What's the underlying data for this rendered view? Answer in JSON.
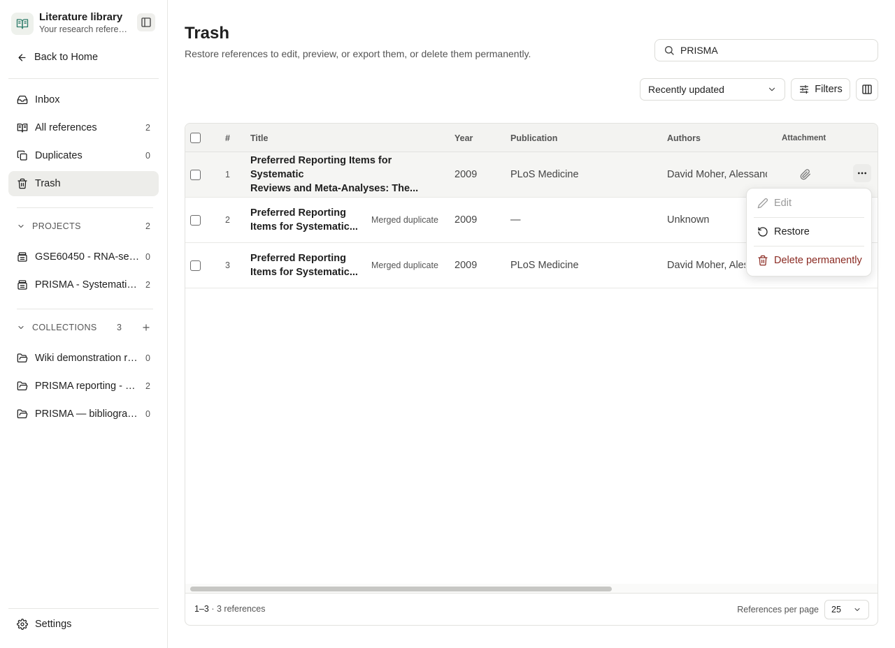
{
  "sidebar": {
    "brand_title": "Literature library",
    "brand_subtitle": "Your research references",
    "back_label": "Back to Home",
    "nav": [
      {
        "label": "Inbox",
        "count": ""
      },
      {
        "label": "All references",
        "count": "2"
      },
      {
        "label": "Duplicates",
        "count": "0"
      },
      {
        "label": "Trash",
        "count": ""
      }
    ],
    "projects": {
      "label": "PROJECTS",
      "count": "2",
      "items": [
        {
          "label": "GSE60450 - RNA-seq analysis",
          "count": "0"
        },
        {
          "label": "PRISMA - Systematic reviews",
          "count": "2"
        }
      ]
    },
    "collections": {
      "label": "COLLECTIONS",
      "count": "3",
      "items": [
        {
          "label": "Wiki demonstration references",
          "count": "0"
        },
        {
          "label": "PRISMA reporting - Core papers",
          "count": "2"
        },
        {
          "label": "PRISMA — bibliography",
          "count": "0"
        }
      ]
    },
    "settings_label": "Settings"
  },
  "main": {
    "title": "Trash",
    "subtitle": "Restore references to edit, preview, or export them, or delete them permanently.",
    "search_value": "PRISMA",
    "sort_value": "Recently updated",
    "filters_label": "Filters"
  },
  "table": {
    "columns": {
      "num": "#",
      "title": "Title",
      "year": "Year",
      "publication": "Publication",
      "authors": "Authors",
      "attachment": "Attachment"
    },
    "rows": [
      {
        "num": "1",
        "title_line1": "Preferred Reporting Items for Systematic",
        "title_line2": "Reviews and Meta-Analyses: The...",
        "badge": "",
        "year": "2009",
        "publication": "PLoS Medicine",
        "authors": "David Moher, Alessandro Liberati"
      },
      {
        "num": "2",
        "title_line1": "Preferred Reporting",
        "title_line2": "Items for Systematic...",
        "badge": "Merged duplicate",
        "year": "2009",
        "publication": "—",
        "authors": "Unknown"
      },
      {
        "num": "3",
        "title_line1": "Preferred Reporting",
        "title_line2": "Items for Systematic...",
        "badge": "Merged duplicate",
        "year": "2009",
        "publication": "PLoS Medicine",
        "authors": "David Moher, Alessandro Liberati"
      }
    ],
    "footer_range": "1–3",
    "footer_count": "· 3 references",
    "per_page_label": "References per page",
    "per_page_value": "25"
  },
  "menu": {
    "edit": "Edit",
    "restore": "Restore",
    "delete": "Delete permanently"
  },
  "colors": {
    "danger": "#8a2a22",
    "active_bg": "#ededea",
    "accent": "#2f7d6b"
  }
}
